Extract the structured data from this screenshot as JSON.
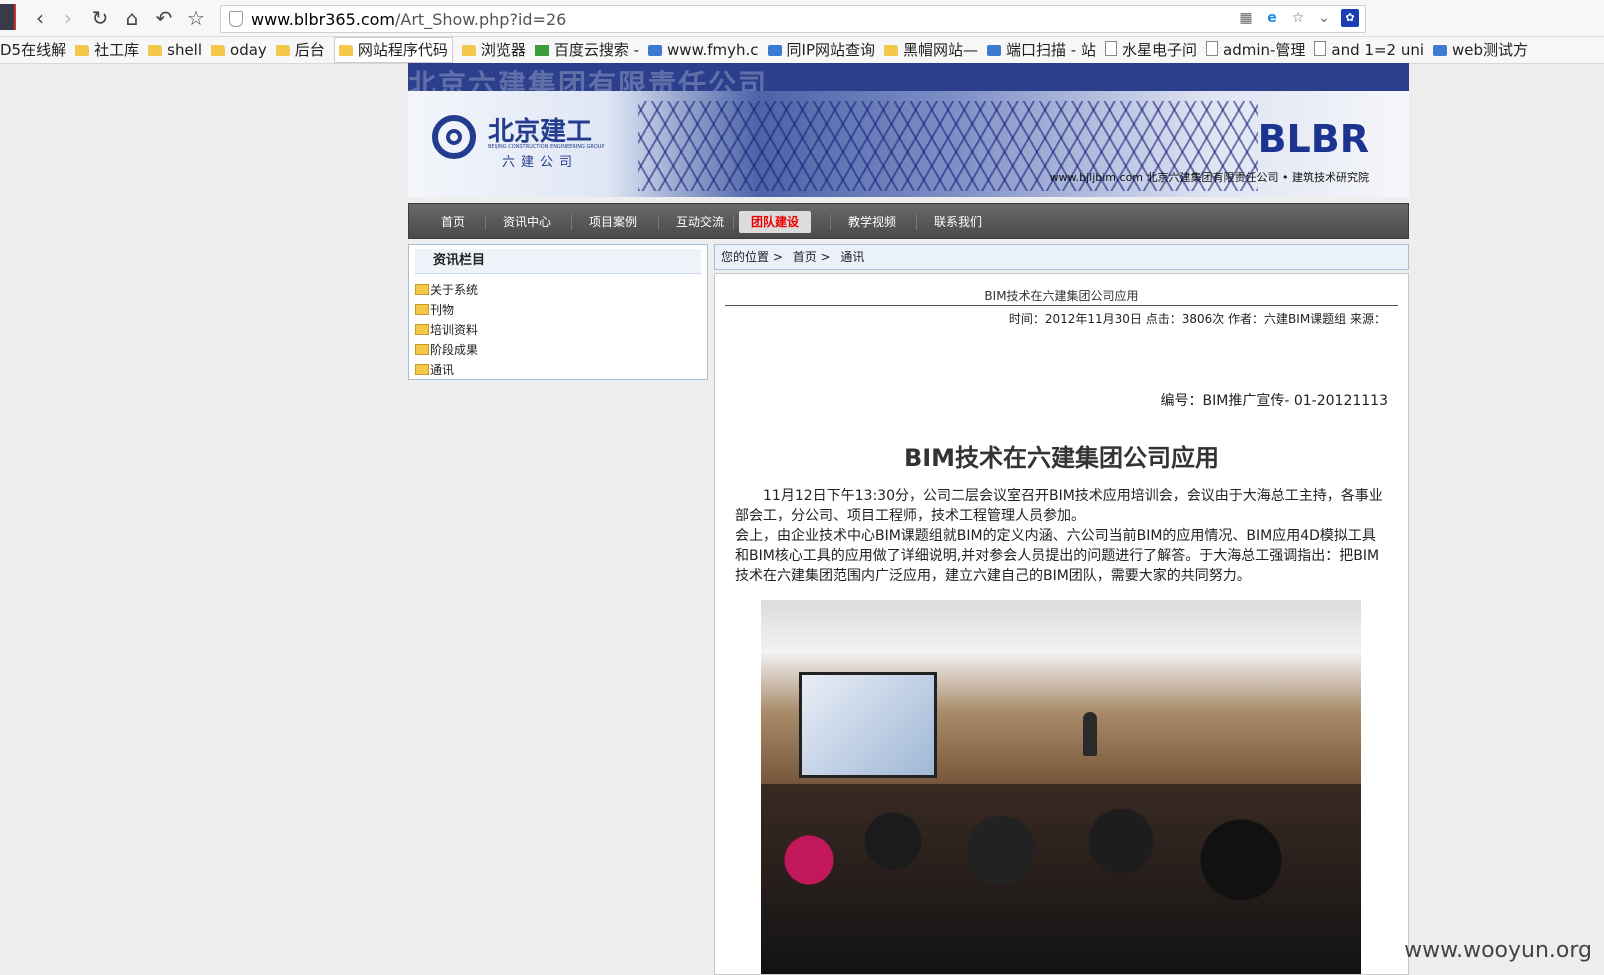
{
  "browser": {
    "url_host": "www.blbr365.com",
    "url_path": "/Art_Show.php?id=26",
    "bookmarks": [
      {
        "label": "D5在线解",
        "icon": "none"
      },
      {
        "label": "社工库",
        "icon": "folder"
      },
      {
        "label": "shell",
        "icon": "folder"
      },
      {
        "label": "oday",
        "icon": "folder"
      },
      {
        "label": "后台",
        "icon": "folder"
      },
      {
        "label": "网站程序代码",
        "icon": "folder"
      },
      {
        "label": "浏览器",
        "icon": "folder"
      },
      {
        "label": "百度云搜索 -",
        "icon": "puzzle"
      },
      {
        "label": "www.fmyh.c",
        "icon": "app"
      },
      {
        "label": "同IP网站查询",
        "icon": "app"
      },
      {
        "label": "黑帽网站—",
        "icon": "folder"
      },
      {
        "label": "端口扫描 - 站",
        "icon": "app"
      },
      {
        "label": "水星电子问",
        "icon": "page"
      },
      {
        "label": "admin-管理",
        "icon": "page"
      },
      {
        "label": "and 1=2 uni",
        "icon": "page"
      },
      {
        "label": "web测试方",
        "icon": "app"
      }
    ]
  },
  "site": {
    "banner_ghost": "北京六建集团有限责任公司",
    "logo_cn": "北京建工",
    "logo_en": "BEIJING CONSTRUCTION ENGINEERING GROUP",
    "logo_sub": "六建公司",
    "brand": "BLBR",
    "slogan": "www.bjljbim.com 北京六建集团有限责任公司 • 建筑技术研究院",
    "nav": [
      "首页",
      "资讯中心",
      "项目案例",
      "互动交流",
      "团队建设",
      "教学视频",
      "联系我们"
    ],
    "nav_current": "团队建设",
    "sidebar": {
      "title": "资讯栏目",
      "items": [
        "关于系统",
        "刊物",
        "培训资料",
        "阶段成果",
        "通讯"
      ]
    },
    "breadcrumb": {
      "prefix": "您的位置 >",
      "home": "首页 >",
      "current": "通讯"
    },
    "article": {
      "title_small": "BIM技术在六建集团公司应用",
      "meta": "时间：2012年11月30日    点击：3806次    作者：六建BIM课题组    来源：",
      "code": "编号：BIM推广宣传- 01-20121113",
      "title": "BIM技术在六建集团公司应用",
      "para1": "11月12日下午13:30分，公司二层会议室召开BIM技术应用培训会，会议由于大海总工主持，各事业部会工，分公司、项目工程师，技术工程管理人员参加。",
      "para2": "会上，由企业技术中心BIM课题组就BIM的定义内涵、六公司当前BIM的应用情况、BIM应用4D模拟工具和BIM核心工具的应用做了详细说明,并对参会人员提出的问题进行了解答。于大海总工强调指出：把BIM技术在六建集团范围内广泛应用，建立六建自己的BIM团队，需要大家的共同努力。"
    }
  },
  "watermark": "www.wooyun.org"
}
